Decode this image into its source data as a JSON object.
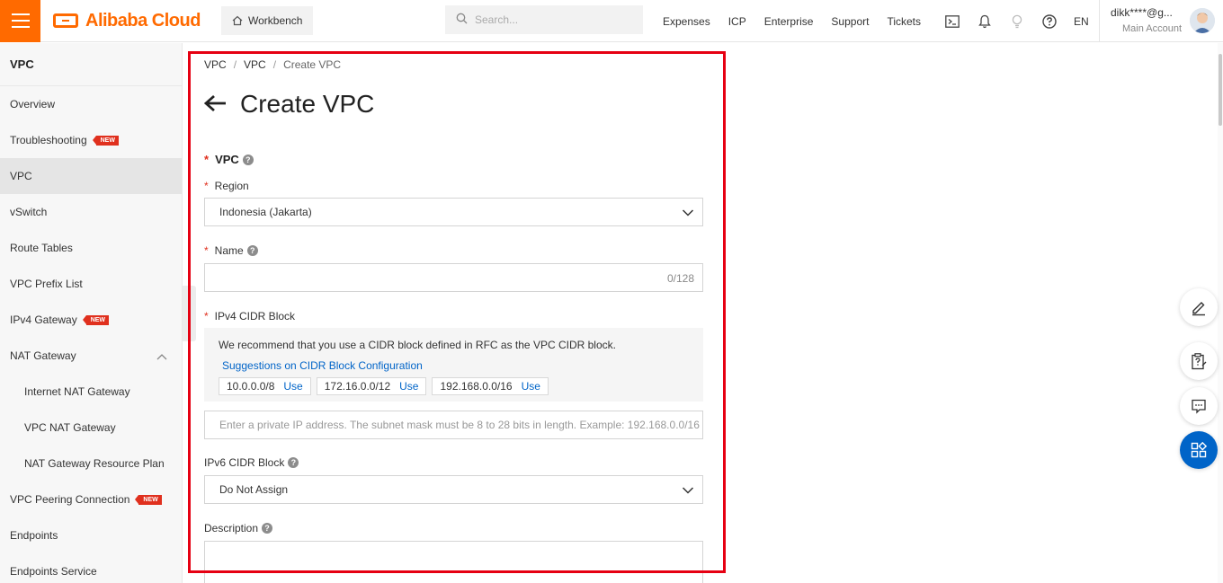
{
  "brand": {
    "name": "Alibaba Cloud",
    "color": "#ff6a00"
  },
  "header": {
    "workbench": "Workbench",
    "search_placeholder": "Search...",
    "links": [
      "Expenses",
      "ICP",
      "Enterprise",
      "Support",
      "Tickets"
    ],
    "icons": [
      "terminal-icon",
      "bell-icon",
      "lightbulb-icon",
      "help-icon"
    ],
    "language": "EN",
    "account": {
      "name": "dikk****@g...",
      "type": "Main Account"
    }
  },
  "sidebar": {
    "title": "VPC",
    "items": [
      {
        "label": "Overview",
        "new": false,
        "sub": false,
        "active": false
      },
      {
        "label": "Troubleshooting",
        "new": true,
        "sub": false,
        "active": false
      },
      {
        "label": "VPC",
        "new": false,
        "sub": false,
        "active": true
      },
      {
        "label": "vSwitch",
        "new": false,
        "sub": false,
        "active": false
      },
      {
        "label": "Route Tables",
        "new": false,
        "sub": false,
        "active": false
      },
      {
        "label": "VPC Prefix List",
        "new": false,
        "sub": false,
        "active": false
      },
      {
        "label": "IPv4 Gateway",
        "new": true,
        "sub": false,
        "active": false
      },
      {
        "label": "NAT Gateway",
        "new": false,
        "sub": false,
        "active": false,
        "expanded": true
      },
      {
        "label": "Internet NAT Gateway",
        "new": false,
        "sub": true,
        "active": false
      },
      {
        "label": "VPC NAT Gateway",
        "new": false,
        "sub": true,
        "active": false
      },
      {
        "label": "NAT Gateway Resource Plan",
        "new": false,
        "sub": true,
        "active": false
      },
      {
        "label": "VPC Peering Connection",
        "new": true,
        "sub": false,
        "active": false
      },
      {
        "label": "Endpoints",
        "new": false,
        "sub": false,
        "active": false
      },
      {
        "label": "Endpoints Service",
        "new": false,
        "sub": false,
        "active": false
      }
    ],
    "new_badge": "NEW"
  },
  "breadcrumb": [
    "VPC",
    "VPC",
    "Create VPC"
  ],
  "page": {
    "title": "Create VPC",
    "back_icon": "arrow-left-icon"
  },
  "form": {
    "section_title": "VPC",
    "required_mark": "*",
    "help_glyph": "?",
    "region": {
      "label": "Region",
      "value": "Indonesia (Jakarta)"
    },
    "name": {
      "label": "Name",
      "value": "",
      "counter": "0/128"
    },
    "ipv4": {
      "label": "IPv4 CIDR Block",
      "recommendation": "We recommend that you use a CIDR block defined in RFC as the VPC CIDR block.",
      "suggestion_link": "Suggestions on CIDR Block Configuration",
      "options": [
        "10.0.0.0/8",
        "172.16.0.0/12",
        "192.168.0.0/16"
      ],
      "use_label": "Use",
      "placeholder": "Enter a private IP address. The subnet mask must be 8 to 28 bits in length. Example: 192.168.0.0/16"
    },
    "ipv6": {
      "label": "IPv6 CIDR Block",
      "value": "Do Not Assign"
    },
    "description": {
      "label": "Description",
      "value": ""
    }
  },
  "float_buttons": [
    "edit-icon",
    "clipboard-help-icon",
    "chat-icon",
    "apps-icon"
  ],
  "colors": {
    "accent": "#ff6a00",
    "link": "#0064c8",
    "highlight_border": "#e60012",
    "badge": "#e0301e"
  }
}
